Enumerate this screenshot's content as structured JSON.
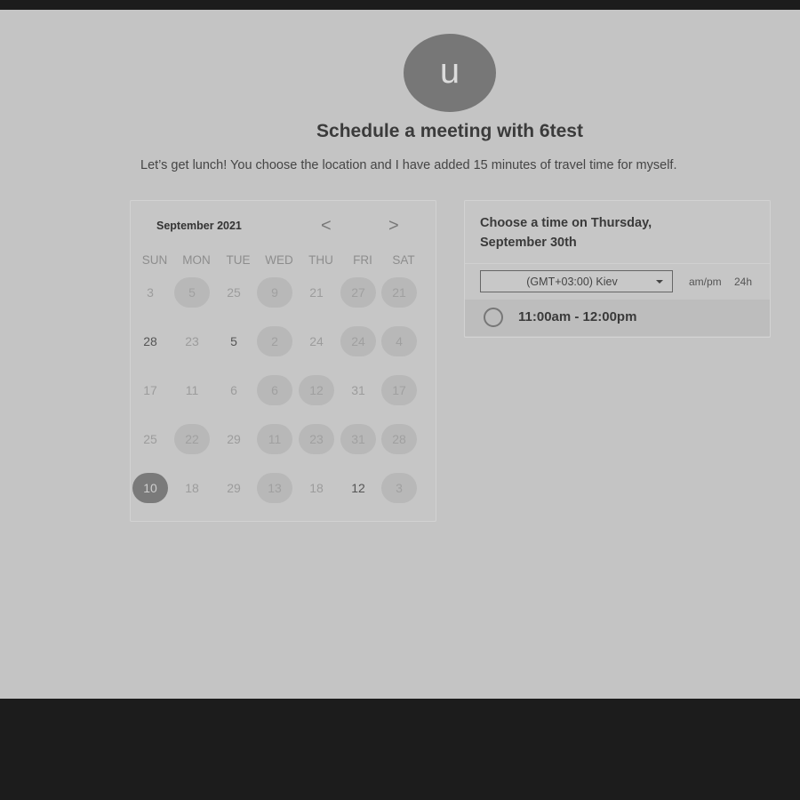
{
  "host": {
    "avatar_letter": "u",
    "title": "Schedule a meeting with 6test",
    "description": "Let’s get lunch! You choose the location and I have added 15 minutes of travel time for myself."
  },
  "calendar": {
    "month_label": "September 2021",
    "prev_icon": "chevron-left-icon",
    "next_icon": "chevron-right-icon",
    "prev_glyph": "<",
    "next_glyph": ">",
    "weekdays": [
      "SUN",
      "MON",
      "TUE",
      "WED",
      "THU",
      "FRI",
      "SAT"
    ],
    "weeks": [
      [
        {
          "d": "3",
          "s": "off"
        },
        {
          "d": "5",
          "s": "avail"
        },
        {
          "d": "25",
          "s": "off"
        },
        {
          "d": "9",
          "s": "avail"
        },
        {
          "d": "21",
          "s": "off"
        },
        {
          "d": "27",
          "s": "avail"
        },
        {
          "d": "21",
          "s": "avail"
        }
      ],
      [
        {
          "d": "28",
          "s": "bold"
        },
        {
          "d": "23",
          "s": "off"
        },
        {
          "d": "5",
          "s": "bold"
        },
        {
          "d": "2",
          "s": "avail"
        },
        {
          "d": "24",
          "s": "off"
        },
        {
          "d": "24",
          "s": "avail"
        },
        {
          "d": "4",
          "s": "avail"
        }
      ],
      [
        {
          "d": "17",
          "s": "off"
        },
        {
          "d": "11",
          "s": "off"
        },
        {
          "d": "6",
          "s": "off"
        },
        {
          "d": "6",
          "s": "avail"
        },
        {
          "d": "12",
          "s": "avail"
        },
        {
          "d": "31",
          "s": "off"
        },
        {
          "d": "17",
          "s": "avail"
        }
      ],
      [
        {
          "d": "25",
          "s": "off"
        },
        {
          "d": "22",
          "s": "avail"
        },
        {
          "d": "29",
          "s": "off"
        },
        {
          "d": "11",
          "s": "avail"
        },
        {
          "d": "23",
          "s": "avail"
        },
        {
          "d": "31",
          "s": "avail"
        },
        {
          "d": "28",
          "s": "avail"
        }
      ],
      [
        {
          "d": "10",
          "s": "sel"
        },
        {
          "d": "18",
          "s": "off"
        },
        {
          "d": "29",
          "s": "off"
        },
        {
          "d": "13",
          "s": "avail"
        },
        {
          "d": "18",
          "s": "off"
        },
        {
          "d": "12",
          "s": "bold"
        },
        {
          "d": "3",
          "s": "avail"
        }
      ]
    ]
  },
  "times": {
    "heading": "Choose a time on Thursday, September 30th",
    "timezone": "(GMT+03:00) Kiev",
    "format_ampm": "am/pm",
    "format_24h": "24h",
    "slots": [
      "11:00am - 12:00pm"
    ]
  },
  "colors": {
    "page_bg": "#c4c4c4",
    "frame_bg": "#1c1c1c",
    "selected_day": "#7a7a7a"
  }
}
